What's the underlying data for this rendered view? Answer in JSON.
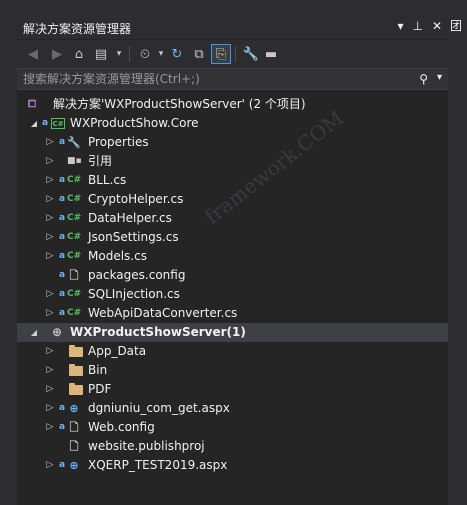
{
  "window": {
    "title": "解决方案资源管理器",
    "title_buttons": [
      "▾",
      "⊥",
      "✕"
    ],
    "side_tab": "团"
  },
  "search": {
    "placeholder": "搜索解决方案资源管理器(Ctrl+;)",
    "value": ""
  },
  "toolbar": {
    "icons": [
      "back-icon",
      "forward-icon",
      "home-icon",
      "switch-views-icon",
      "pending-changes-filter-icon",
      "refresh-icon",
      "collapse-all-icon",
      "show-all-files-icon",
      "properties-icon",
      "preview-icon"
    ]
  },
  "watermark": "framework.COM",
  "tree": {
    "solution": "解决方案'WXProductShowServer' (2 个项目)",
    "project1": {
      "name": "WXProductShow.Core",
      "items": [
        {
          "label": "Properties",
          "icon": "wrench-icon"
        },
        {
          "label": "引用",
          "icon": "references-icon"
        },
        {
          "label": "BLL.cs",
          "icon": "csharp-file-icon"
        },
        {
          "label": "CryptoHelper.cs",
          "icon": "csharp-file-icon"
        },
        {
          "label": "DataHelper.cs",
          "icon": "csharp-file-icon"
        },
        {
          "label": "JsonSettings.cs",
          "icon": "csharp-file-icon"
        },
        {
          "label": "Models.cs",
          "icon": "csharp-file-icon"
        },
        {
          "label": "packages.config",
          "icon": "config-file-icon"
        },
        {
          "label": "SQLInjection.cs",
          "icon": "csharp-file-icon"
        },
        {
          "label": "WebApiDataConverter.cs",
          "icon": "csharp-file-icon"
        }
      ]
    },
    "project2": {
      "name": "WXProductShowServer(1)",
      "items": [
        {
          "label": "App_Data",
          "icon": "folder-icon"
        },
        {
          "label": "Bin",
          "icon": "folder-icon"
        },
        {
          "label": "PDF",
          "icon": "folder-icon"
        },
        {
          "label": "dgniuniu_com_get.aspx",
          "icon": "aspx-file-icon"
        },
        {
          "label": "Web.config",
          "icon": "config-file-icon"
        },
        {
          "label": "website.publishproj",
          "icon": "publishproj-file-icon"
        },
        {
          "label": "XQERP_TEST2019.aspx",
          "icon": "aspx-file-icon"
        }
      ]
    }
  },
  "colors": {
    "background": "#252526",
    "chrome": "#2d2d30",
    "selected_row": "#3f3f46",
    "csharp": "#4fc15d",
    "lock": "#6cb4ff",
    "folder": "#dcb67a"
  }
}
